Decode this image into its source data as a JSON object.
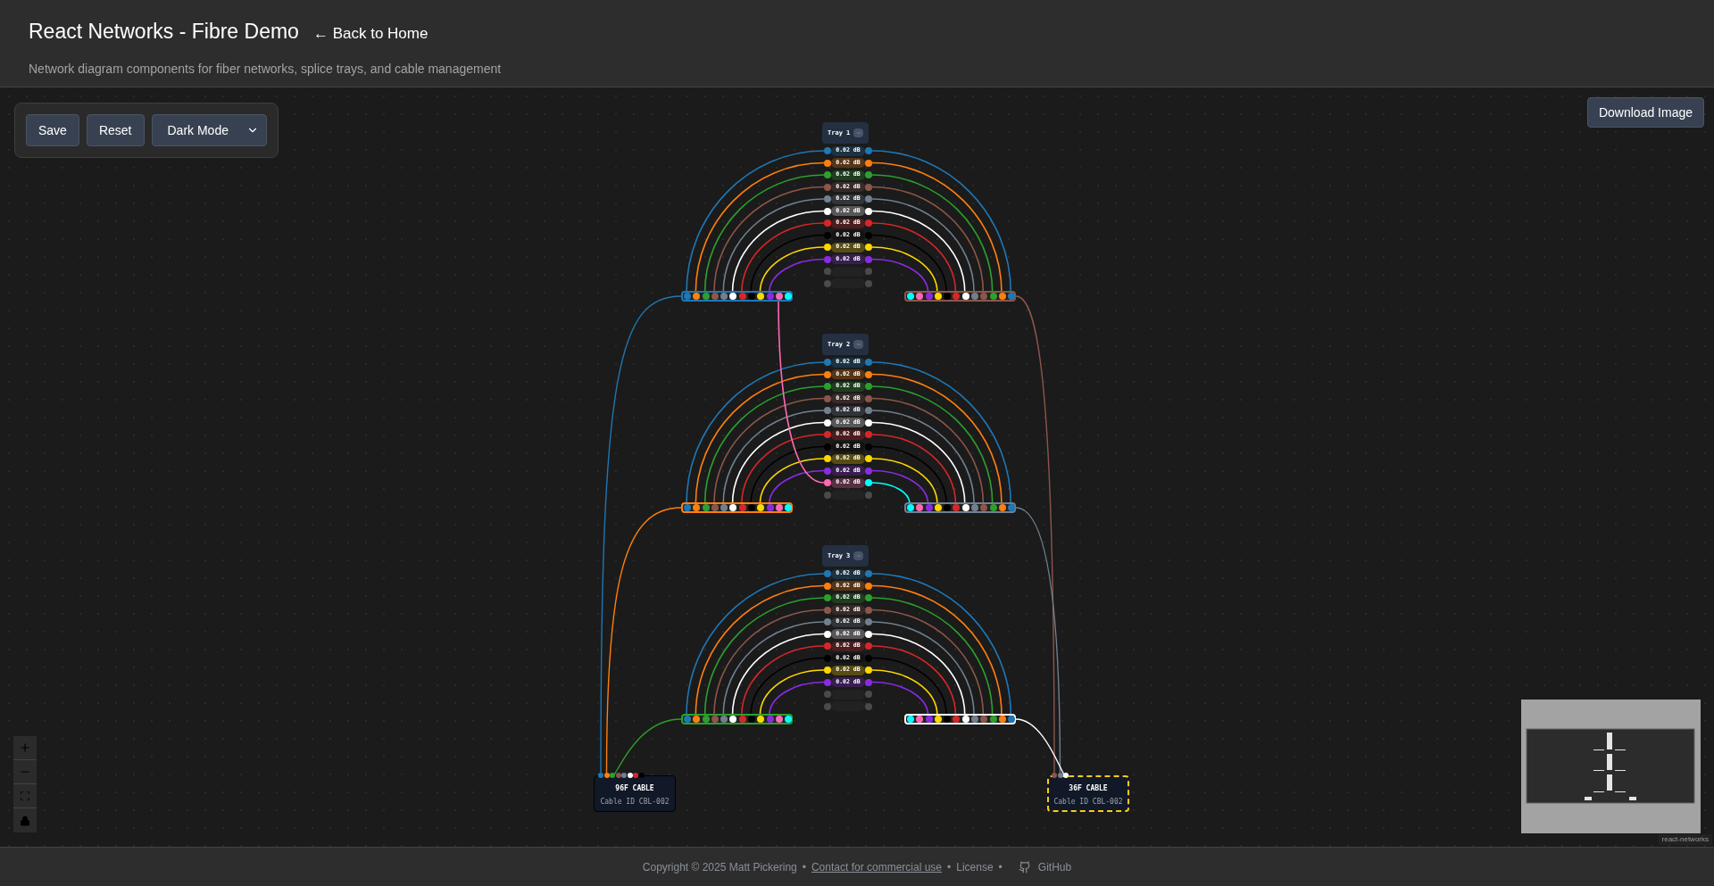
{
  "header": {
    "title": "React Networks - Fibre Demo",
    "back_link": "← Back to Home",
    "subtitle": "Network diagram components for fiber networks, splice trays, and cable management"
  },
  "toolbar": {
    "buttons": [
      "Save",
      "Reset"
    ],
    "theme_select": "Dark Mode"
  },
  "download_button": "Download Image",
  "bundle_fibers": [
    {
      "color": "#1f77b4"
    },
    {
      "color": "#ff7f0e"
    },
    {
      "color": "#2ca02c"
    },
    {
      "color": "#8c564b"
    },
    {
      "color": "#708090"
    },
    {
      "color": "#ffffff"
    },
    {
      "color": "#d62728"
    },
    {
      "color": "#000000"
    },
    {
      "color": "#ffd700"
    },
    {
      "color": "#8a2be2"
    },
    {
      "color": "#ff69b4"
    },
    {
      "color": "#00ffff"
    }
  ],
  "trays": [
    {
      "label": "Tray 1",
      "left_bundle": {
        "color": "#1f77b4"
      },
      "right_bundle": {
        "color": "#8c564b"
      },
      "rows": [
        {
          "kind": "splice",
          "color": "#1f77b4",
          "reading": "0.02 dB"
        },
        {
          "kind": "splice",
          "color": "#ff7f0e",
          "reading": "0.02 dB"
        },
        {
          "kind": "splice",
          "color": "#2ca02c",
          "reading": "0.02 dB"
        },
        {
          "kind": "splice",
          "color": "#8c564b",
          "reading": "0.02 dB"
        },
        {
          "kind": "splice",
          "color": "#708090",
          "reading": "0.02 dB"
        },
        {
          "kind": "splice",
          "color": "#ffffff",
          "reading": "0.02 dB"
        },
        {
          "kind": "splice",
          "color": "#d62728",
          "reading": "0.02 dB"
        },
        {
          "kind": "splice",
          "color": "#000000",
          "reading": "0.02 dB"
        },
        {
          "kind": "splice",
          "color": "#ffd700",
          "reading": "0.02 dB"
        },
        {
          "kind": "splice",
          "color": "#8a2be2",
          "reading": "0.02 dB"
        },
        {
          "kind": "empty"
        },
        {
          "kind": "empty"
        }
      ]
    },
    {
      "label": "Tray 2",
      "left_bundle": {
        "color": "#ff7f0e"
      },
      "right_bundle": {
        "color": "#708090"
      },
      "rows": [
        {
          "kind": "splice",
          "color": "#1f77b4",
          "reading": "0.02 dB"
        },
        {
          "kind": "splice",
          "color": "#ff7f0e",
          "reading": "0.02 dB"
        },
        {
          "kind": "splice",
          "color": "#2ca02c",
          "reading": "0.02 dB"
        },
        {
          "kind": "splice",
          "color": "#8c564b",
          "reading": "0.02 dB"
        },
        {
          "kind": "splice",
          "color": "#708090",
          "reading": "0.02 dB"
        },
        {
          "kind": "splice",
          "color": "#ffffff",
          "reading": "0.02 dB"
        },
        {
          "kind": "splice",
          "color": "#d62728",
          "reading": "0.02 dB"
        },
        {
          "kind": "splice",
          "color": "#000000",
          "reading": "0.02 dB"
        },
        {
          "kind": "splice",
          "color": "#ffd700",
          "reading": "0.02 dB"
        },
        {
          "kind": "splice",
          "color": "#8a2be2",
          "reading": "0.02 dB"
        },
        {
          "kind": "cross_splice",
          "color": "#ff69b4",
          "right_dot": {
            "color": "#00ffff"
          },
          "reading": "0.02 dB"
        },
        {
          "kind": "empty"
        }
      ]
    },
    {
      "label": "Tray 3",
      "left_bundle": {
        "color": "#2ca02c"
      },
      "right_bundle": {
        "color": "#ffffff"
      },
      "rows": [
        {
          "kind": "splice",
          "color": "#1f77b4",
          "reading": "0.02 dB"
        },
        {
          "kind": "splice",
          "color": "#ff7f0e",
          "reading": "0.02 dB"
        },
        {
          "kind": "splice",
          "color": "#2ca02c",
          "reading": "0.02 dB"
        },
        {
          "kind": "splice",
          "color": "#8c564b",
          "reading": "0.02 dB"
        },
        {
          "kind": "splice",
          "color": "#708090",
          "reading": "0.02 dB"
        },
        {
          "kind": "splice",
          "color": "#ffffff",
          "reading": "0.02 dB"
        },
        {
          "kind": "splice",
          "color": "#d62728",
          "reading": "0.02 dB"
        },
        {
          "kind": "splice",
          "color": "#000000",
          "reading": "0.02 dB"
        },
        {
          "kind": "splice",
          "color": "#ffd700",
          "reading": "0.02 dB"
        },
        {
          "kind": "splice",
          "color": "#8a2be2",
          "reading": "0.02 dB"
        },
        {
          "kind": "empty"
        },
        {
          "kind": "empty"
        }
      ]
    }
  ],
  "cables": [
    {
      "title": "96F CABLE",
      "cable_id": "Cable ID CBL-002",
      "selected": false,
      "fibers": [
        {
          "color": "#1f77b4"
        },
        {
          "color": "#ff7f0e"
        },
        {
          "color": "#2ca02c"
        },
        {
          "color": "#8c564b"
        },
        {
          "color": "#708090"
        },
        {
          "color": "#ffffff"
        },
        {
          "color": "#d62728"
        },
        {
          "color": "#000000"
        }
      ]
    },
    {
      "title": "36F CABLE",
      "cable_id": "Cable ID CBL-002",
      "selected": true,
      "fibers": [
        {
          "color": "#8c564b"
        },
        {
          "color": "#708090"
        },
        {
          "color": "#ffffff"
        }
      ]
    }
  ],
  "attribution": "react-networks",
  "footer": [
    {
      "kind": "text",
      "text": "Copyright © 2025 Matt Pickering"
    },
    {
      "kind": "separator",
      "text": "•"
    },
    {
      "kind": "link",
      "text": "Contact for commercial use"
    },
    {
      "kind": "separator",
      "text": "•"
    },
    {
      "kind": "plain_link",
      "text": "License"
    },
    {
      "kind": "separator",
      "text": "•"
    },
    {
      "kind": "github",
      "text": "GitHub"
    }
  ]
}
